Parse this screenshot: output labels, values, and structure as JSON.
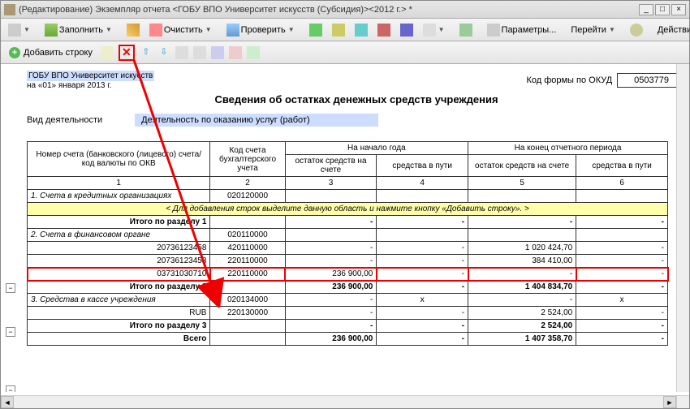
{
  "window": {
    "title": "(Редактирование) Экземпляр отчета <ГОБУ ВПО Университет искусств (Субсидия)><2012 г.> *",
    "min": "_",
    "max": "□",
    "close": "×"
  },
  "toolbar1": {
    "fill": "Заполнить",
    "clear": "Очистить",
    "check": "Проверить",
    "params": "Параметры...",
    "goto": "Перейти",
    "actions": "Действия"
  },
  "toolbar2": {
    "add_row": "Добавить строку"
  },
  "header": {
    "org": "ГОБУ ВПО Университет искусств",
    "date": "на «01» января 2013 г.",
    "okud_label": "Код формы по ОКУД",
    "okud_value": "0503779",
    "title": "Сведения об остатках денежных средств учреждения",
    "activity_label": "Вид деятельности",
    "activity_value": "Деятельность по оказанию услуг (работ)"
  },
  "columns": {
    "c1": "Номер счета (банковского (лицевого) счета/код валюты по ОКВ",
    "c2": "Код счета бухгалтерского учета",
    "grp_start": "На начало года",
    "grp_end": "На конец отчетного периода",
    "ost": "остаток средств на счете",
    "put": "средства в пути",
    "n1": "1",
    "n2": "2",
    "n3": "3",
    "n4": "4",
    "n5": "5",
    "n6": "6"
  },
  "rows": {
    "s1": {
      "title": "1. Счета в кредитных организациях",
      "code": "020120000"
    },
    "hint": "< Для добавления строк выделите данную область и нажмите кнопку «Добавить строку». >",
    "t1": {
      "label": "Итого по разделу 1"
    },
    "s2": {
      "title": "2. Счета в финансовом органе",
      "code": "020110000"
    },
    "r1": {
      "acc": "20736123458",
      "code": "420110000",
      "end_ost": "1 020 424,70"
    },
    "r2": {
      "acc": "20736123458",
      "code": "220110000",
      "end_ost": "384 410,00"
    },
    "r3": {
      "acc": "03731030710",
      "code": "220110000",
      "start_ost": "236 900,00"
    },
    "t2": {
      "label": "Итого по разделу 2",
      "start_ost": "236 900,00",
      "end_ost": "1 404 834,70"
    },
    "s3": {
      "title": "3. Средства в кассе учреждения",
      "code": "020134000",
      "x": "х"
    },
    "r4": {
      "acc": "RUB",
      "code": "220130000",
      "end_ost": "2 524,00"
    },
    "t3": {
      "label": "Итого по разделу 3",
      "end_ost": "2 524,00"
    },
    "total": {
      "label": "Всего",
      "start_ost": "236 900,00",
      "end_ost": "1 407 358,70"
    }
  }
}
